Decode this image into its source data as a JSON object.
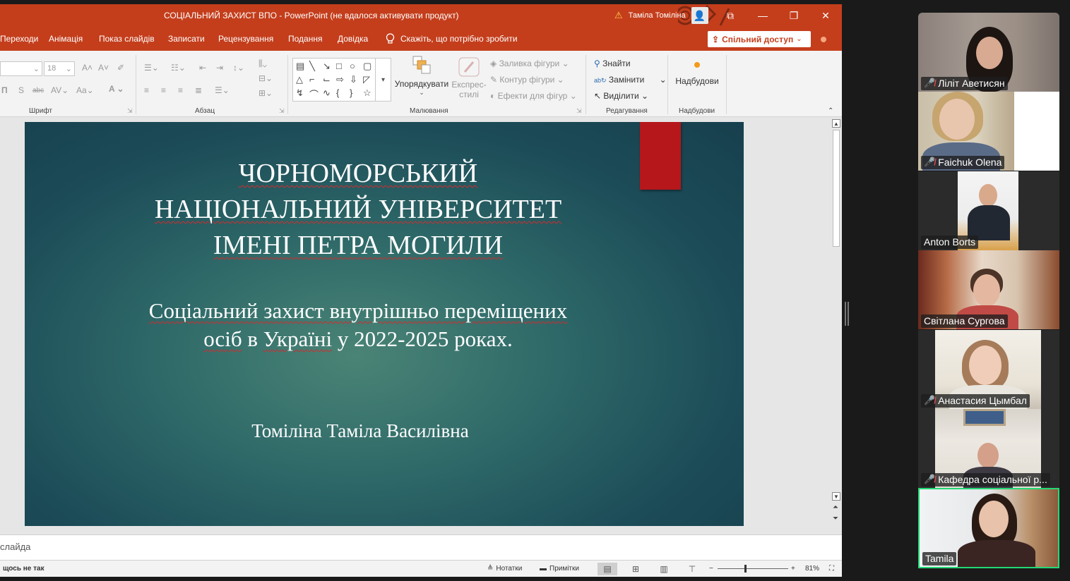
{
  "window": {
    "title": "СОЦІАЛЬНИЙ ЗАХИСТ ВПО  -  PowerPoint (не вдалося активувати продукт)",
    "user_name": "Таміла Томіліна"
  },
  "ribbon_tabs": [
    "Переходи",
    "Анімація",
    "Показ слайдів",
    "Записати",
    "Рецензування",
    "Подання",
    "Довідка"
  ],
  "tell_me": "Скажіть, що потрібно зробити",
  "share_label": "Спільний доступ",
  "ribbon": {
    "font_size": "18",
    "font_group_label": "Шрифт",
    "paragraph_group_label": "Абзац",
    "drawing_group_label": "Малювання",
    "editing_group_label": "Редагування",
    "addins_group_label": "Надбудови",
    "arrange_label": "Упорядкувати",
    "quick_styles_label": "Експрес-стилі",
    "shape_fill": "Заливка фігури",
    "shape_outline": "Контур фігури",
    "shape_effects": "Ефекти для фігур",
    "find": "Знайти",
    "replace": "Замінити",
    "select": "Виділити",
    "addins": "Надбудови"
  },
  "slide": {
    "title_lines": [
      "ЧОРНОМОРСЬКИЙ",
      "НАЦІОНАЛЬНИЙ УНІВЕРСИТЕТ",
      "ІМЕНІ ПЕТРА МОГИЛИ"
    ],
    "subtitle_line1": "Соціальний захист внутрішньо переміщених",
    "subtitle_line2a": "осіб",
    "subtitle_line2b": " в ",
    "subtitle_line2c": "Україні",
    "subtitle_line2d": " у 2022-2025 роках.",
    "author": "Томіліна Таміла Василівна"
  },
  "notes_placeholder": "слайда",
  "status": {
    "feedback": "щось не так",
    "notes": "Нотатки",
    "comments": "Примітки",
    "zoom": "81%"
  },
  "participants": [
    {
      "name": "Ліліт Аветисян",
      "muted": true
    },
    {
      "name": "Faichuk Olena",
      "muted": true
    },
    {
      "name": "Anton Borts",
      "muted": false
    },
    {
      "name": "Світлана Сургова",
      "muted": false
    },
    {
      "name": "Анастасия Цымбал",
      "muted": true
    },
    {
      "name": "Кафедра соціальної р...",
      "muted": true
    },
    {
      "name": "Tamila",
      "muted": false
    }
  ],
  "colors": {
    "ppt_accent": "#c43e1c",
    "active_speaker": "#23d976",
    "slide_red_bar": "#b5171b"
  }
}
